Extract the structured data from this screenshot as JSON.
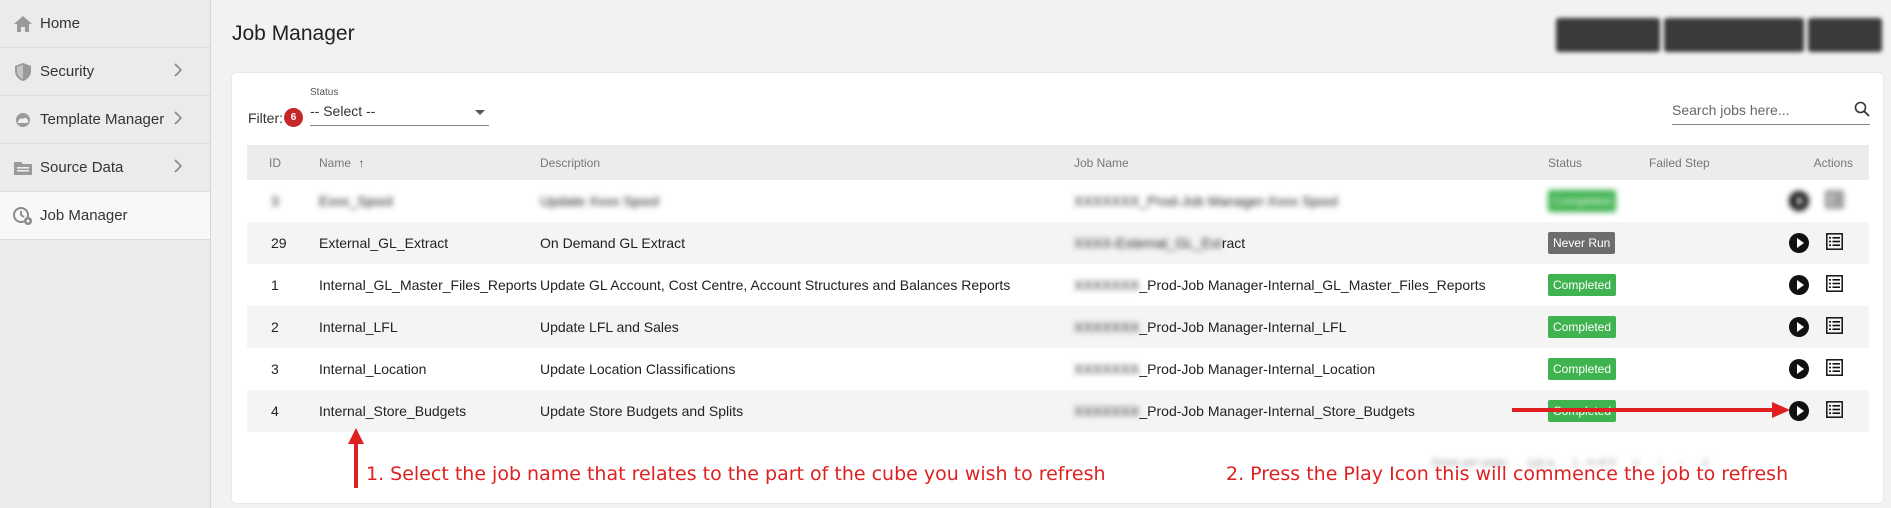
{
  "sidebar": {
    "items": [
      {
        "label": "Home",
        "icon": "home-icon",
        "has_chevron": false
      },
      {
        "label": "Security",
        "icon": "shield-icon",
        "has_chevron": true
      },
      {
        "label": "Template Manager",
        "icon": "cloud-icon",
        "has_chevron": true
      },
      {
        "label": "Source Data",
        "icon": "folder-icon",
        "has_chevron": true
      },
      {
        "label": "Job Manager",
        "icon": "job-gear-icon",
        "has_chevron": false,
        "active": true
      }
    ]
  },
  "header": {
    "title": "Job Manager"
  },
  "filter": {
    "label": "Filter:",
    "count": "6",
    "status_caption": "Status",
    "status_value": "-- Select --"
  },
  "search": {
    "placeholder": "Search jobs here..."
  },
  "table": {
    "columns": {
      "id": "ID",
      "name": "Name",
      "description": "Description",
      "job_name": "Job Name",
      "status": "Status",
      "failed_step": "Failed Step",
      "actions": "Actions"
    },
    "rows": [
      {
        "id": "3",
        "name": "Exxx_Spool",
        "description": "Update Xxxx Spool",
        "job_name_hidden": "XXXXXXX_Prod-Job Manager-Xxxx Spool",
        "job_name_visible": "",
        "status": "Completed",
        "status_kind": "done",
        "blurred": true
      },
      {
        "id": "29",
        "name": "External_GL_Extract",
        "description": "On Demand GL Extract",
        "job_name_hidden": "XXXX-External_GL_Ext",
        "job_name_visible": "ract",
        "status": "Never Run",
        "status_kind": "never",
        "blurred": false
      },
      {
        "id": "1",
        "name": "Internal_GL_Master_Files_Reports",
        "description": "Update GL Account, Cost Centre, Account Structures and Balances Reports",
        "job_name_hidden": "XXXXXXX",
        "job_name_visible": "_Prod-Job Manager-Internal_GL_Master_Files_Reports",
        "status": "Completed",
        "status_kind": "done",
        "blurred": false
      },
      {
        "id": "2",
        "name": "Internal_LFL",
        "description": "Update LFL and Sales",
        "job_name_hidden": "XXXXXXX",
        "job_name_visible": "_Prod-Job Manager-Internal_LFL",
        "status": "Completed",
        "status_kind": "done",
        "blurred": false
      },
      {
        "id": "3",
        "name": "Internal_Location",
        "description": "Update Location Classifications",
        "job_name_hidden": "XXXXXXX",
        "job_name_visible": "_Prod-Job Manager-Internal_Location",
        "status": "Completed",
        "status_kind": "done",
        "blurred": false
      },
      {
        "id": "4",
        "name": "Internal_Store_Budgets",
        "description": "Update Store Budgets and Splits",
        "job_name_hidden": "XXXXXXX",
        "job_name_visible": "_Prod-Job Manager-Internal_Store_Budgets",
        "status": "Completed",
        "status_kind": "done",
        "blurred": false
      }
    ]
  },
  "annotations": {
    "step1": "1. Select the job name that relates to the part of the cube you wish to refresh",
    "step2": "2. Press the Play Icon  this will commence the job to refresh"
  },
  "colors": {
    "completed": "#3fb34f",
    "never_run": "#6d6d6d",
    "badge": "#c62828",
    "annotation": "#e02020"
  }
}
